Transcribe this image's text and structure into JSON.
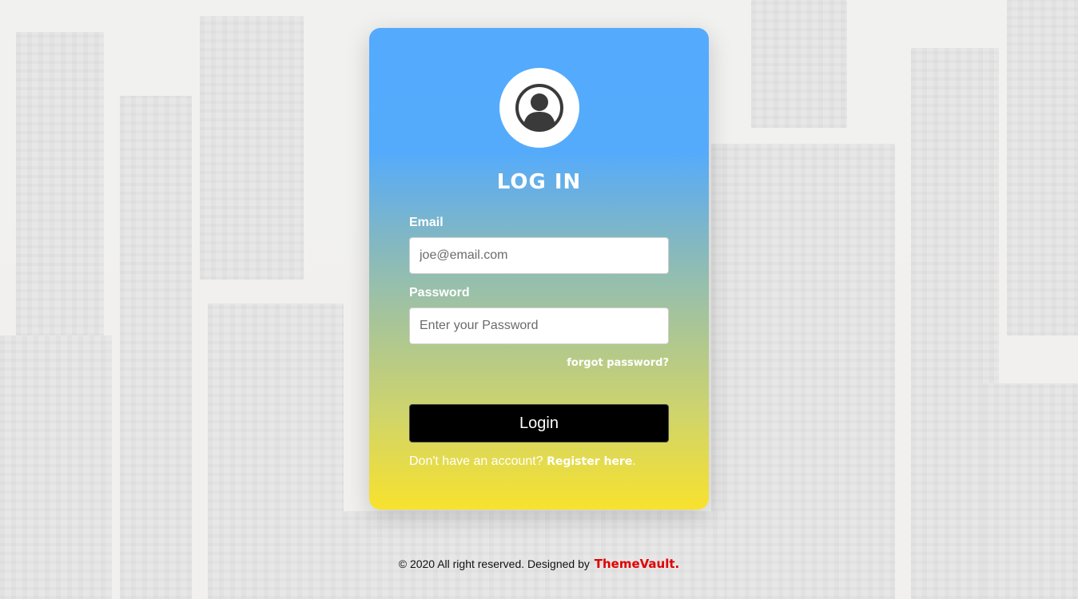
{
  "login": {
    "title": "LOG IN",
    "email_label": "Email",
    "email_placeholder": "joe@email.com",
    "password_label": "Password",
    "password_placeholder": "Enter your Password",
    "forgot_link": "forgot password?",
    "login_button": "Login",
    "register_prompt": "Don't have an account?",
    "register_link": "Register here",
    "register_suffix": "."
  },
  "footer": {
    "copyright": "© 2020 All right reserved. Designed by",
    "brand": "ThemeVault."
  },
  "icons": {
    "avatar": "user-circle-icon"
  },
  "colors": {
    "gradient_top": "#54aafc",
    "gradient_bottom": "#f8e22d",
    "button": "#000000",
    "brand": "#e00000"
  }
}
